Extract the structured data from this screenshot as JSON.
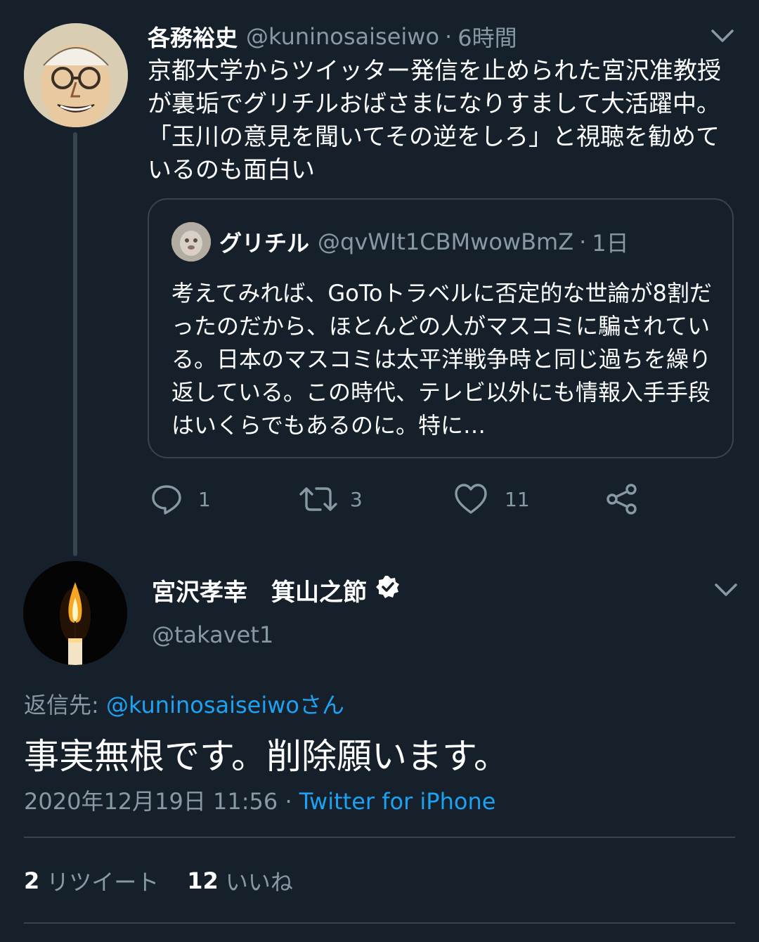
{
  "colors": {
    "background": "#15202b",
    "border": "#38444d",
    "secondary_text": "#8899a6",
    "link": "#1da1f2"
  },
  "parent_tweet": {
    "display_name": "各務裕史",
    "handle": "@kuninosaiseiwo",
    "separator": "·",
    "time": "6時間",
    "text": "京都大学からツイッター発信を止められた宮沢准教授が裏垢でグリチルおばさまになりすまして大活躍中。「玉川の意見を聞いてその逆をしろ」と視聴を勧めているのも面白い",
    "quoted": {
      "display_name": "グリチル",
      "handle": "@qvWIt1CBMwowBmZ",
      "separator": "·",
      "time": "1日",
      "text": "考えてみれば、GoToトラベルに否定的な世論が8割だったのだから、ほとんどの人がマスコミに騙されている。日本のマスコミは太平洋戦争時と同じ過ちを繰り返している。この時代、テレビ以外にも情報入手手段はいくらでもあるのに。特に…"
    },
    "actions": {
      "reply_count": "1",
      "retweet_count": "3",
      "like_count": "11"
    },
    "icons": [
      "reply-icon",
      "retweet-icon",
      "like-icon",
      "share-icon",
      "chevron-down-icon"
    ]
  },
  "main_tweet": {
    "display_name": "宮沢孝幸　箕山之節",
    "handle": "@takavet1",
    "reply_prefix": "返信先: ",
    "reply_mention": "@kuninosaiseiwoさん",
    "text": "事実無根です。削除願います。",
    "timestamp": "2020年12月19日 11:56",
    "meta_separator": " · ",
    "source": "Twitter for iPhone",
    "stats": {
      "retweets_num": "2",
      "retweets_label": "リツイート",
      "likes_num": "12",
      "likes_label": "いいね"
    },
    "icons": [
      "verified-badge-icon",
      "chevron-down-icon",
      "candle-avatar"
    ]
  }
}
